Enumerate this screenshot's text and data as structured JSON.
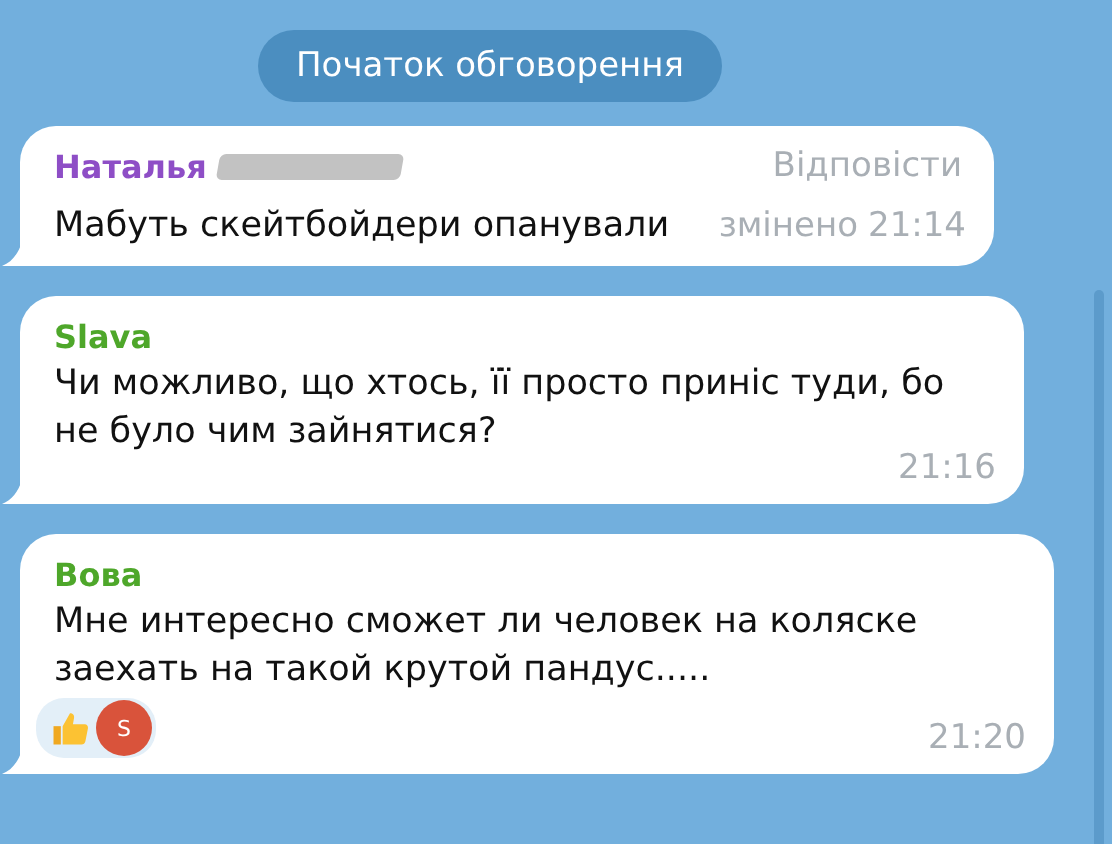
{
  "header": {
    "label": "Початок обговорення"
  },
  "messages": [
    {
      "author": "Наталья",
      "color": "#8e4ec6",
      "name_redacted": true,
      "text": "Мабуть скейтбойдери опанували",
      "edited_label": "змінено",
      "time": "21:14",
      "reply_label": "Відповісти"
    },
    {
      "author": "Slava",
      "color": "#4ea72a",
      "text": "Чи можливо, що хтось, її просто приніс туди, бо не було чим зайнятися?",
      "time": "21:16"
    },
    {
      "author": "Вова",
      "color": "#4ea72a",
      "text": "Мне интересно сможет ли человек на коляске заехать на такой крутой пандус.....",
      "time": "21:20",
      "reaction": {
        "avatar_letter": "S"
      }
    }
  ]
}
